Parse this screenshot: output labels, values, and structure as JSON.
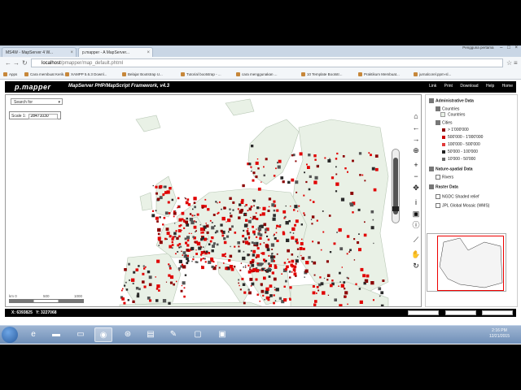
{
  "browser": {
    "tabs": [
      {
        "label": "MS4W - MapServer 4 W...",
        "active": false
      },
      {
        "label": "p.mapper - A MapServer...",
        "active": true
      }
    ],
    "window_user": "Pengguna pertama",
    "url_host": "localhost",
    "url_path": "/pmapper/map_default.phtml",
    "bookmarks": [
      "Apps",
      "Cara membuat Kerik...",
      "XAMPP 5.6.3 Downl...",
      "Belajar Bootstrap U...",
      "Tutorial bootstrap - ...",
      "cara menggunakan ...",
      "10 Template Bootstr...",
      "Praktikum Membuat...",
      "jurnalcorel.ppm-sl..."
    ]
  },
  "app": {
    "brand": "p.mapper",
    "subtitle": "MapServer PHP/MapScript Framework, v4.3",
    "header_links": [
      "Link",
      "Print",
      "Download",
      "Help",
      "Home"
    ],
    "search_placeholder": "Search for",
    "scale_label": "Scale 1:",
    "scale_value": "28471030",
    "scalebar_ticks": [
      "km 0",
      "500",
      "1000"
    ],
    "coords_x": "X: 6393825",
    "coords_y": "Y: 3227068"
  },
  "toc": {
    "groups": [
      {
        "name": "Administrative Data",
        "items": [
          {
            "label": "Countries",
            "sub": [
              "Countries"
            ]
          },
          {
            "label": "Cities",
            "legend": [
              {
                "label": "> 1'000'000",
                "color": "#8b0000"
              },
              {
                "label": "500'000 - 1'000'000",
                "color": "#cc0000"
              },
              {
                "label": "100'000 - 500'000",
                "color": "#e03a3a"
              },
              {
                "label": "50'000 - 100'000",
                "color": "#222222"
              },
              {
                "label": "10'000 - 50'000",
                "color": "#666666"
              }
            ]
          }
        ]
      },
      {
        "name": "Nature-spatial Data",
        "items": [
          {
            "label": "Rivers"
          }
        ]
      },
      {
        "name": "Raster Data",
        "items": [
          {
            "label": "NGDC Shaded relief"
          },
          {
            "label": "JPL Global Mosaic (WMS)"
          }
        ]
      }
    ]
  },
  "taskbar": {
    "time": "2:16 PM",
    "date": "12/21/2015"
  },
  "colors": {
    "land": "#e9f1e6",
    "border": "#b8c7b5",
    "city_red": "#e00000",
    "city_dark": "#2a2a2a"
  },
  "map_data": {
    "seed": 1234
  }
}
